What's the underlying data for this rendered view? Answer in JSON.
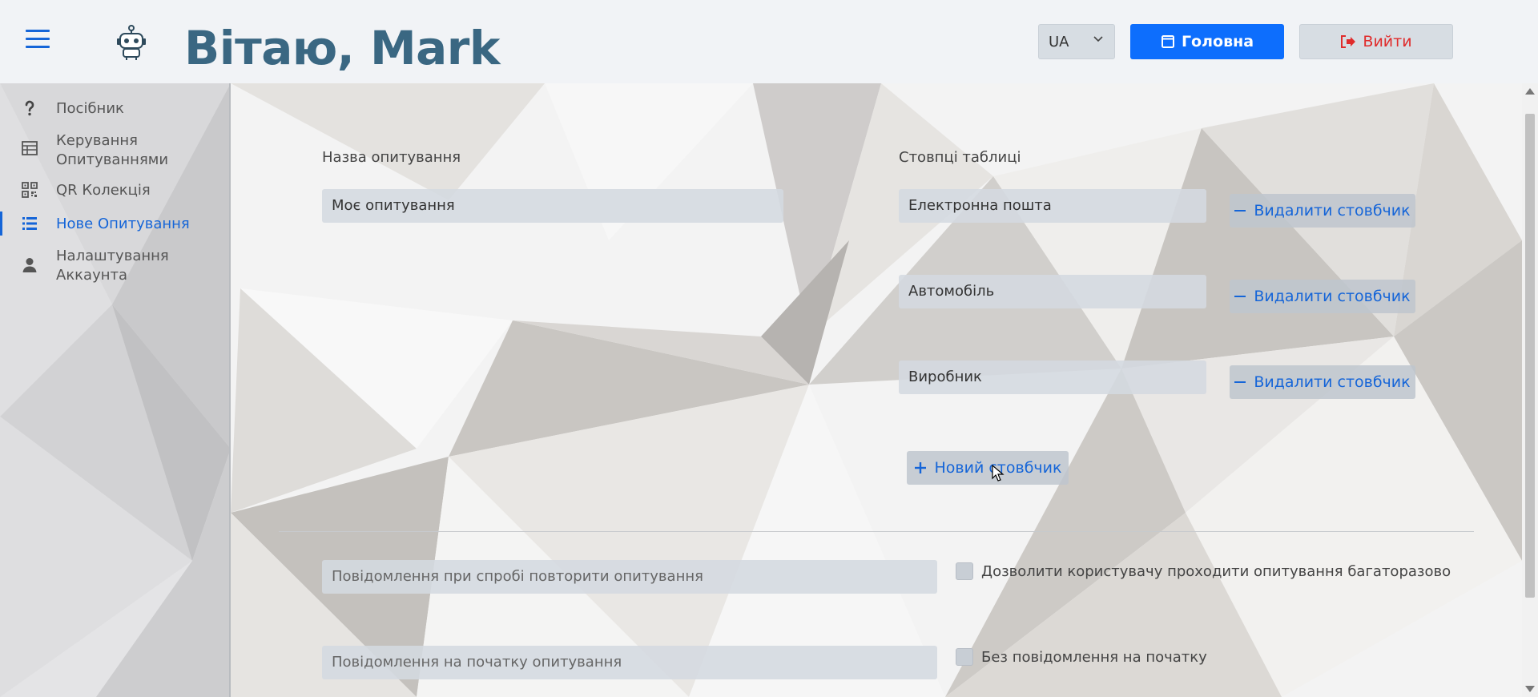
{
  "header": {
    "greeting": "Вітаю, Mark",
    "language": "UA",
    "home_label": "Головна",
    "logout_label": "Вийти"
  },
  "sidebar": {
    "items": [
      {
        "label": "Посібник",
        "icon": "question-icon"
      },
      {
        "label": "Керування Опитуваннями",
        "icon": "table-icon"
      },
      {
        "label": "QR Колекція",
        "icon": "qr-icon"
      },
      {
        "label": "Нове Опитування",
        "icon": "list-icon",
        "active": true
      },
      {
        "label": "Налаштування Аккаунта",
        "icon": "user-icon"
      }
    ]
  },
  "form": {
    "survey_name_label": "Назва опитування",
    "survey_name_value": "Моє опитування",
    "columns_label": "Стовпці таблиці",
    "columns": [
      {
        "value": "Електронна пошта",
        "delete_label": "Видалити стовбчик"
      },
      {
        "value": "Автомобіль",
        "delete_label": "Видалити стовбчик"
      },
      {
        "value": "Виробник",
        "delete_label": "Видалити стовбчик"
      }
    ],
    "new_column_label": "Новий стовбчик",
    "repeat_message_placeholder": "Повідомлення при спробі повторити опитування",
    "allow_repeat_label": "Дозволити користувачу проходити опитування багаторазово",
    "start_message_placeholder": "Повідомлення на початку опитування",
    "no_start_message_label": "Без повідомлення на початку"
  },
  "colors": {
    "accent": "#1565d8",
    "primary_button": "#0d6efd",
    "greeting": "#3a6782",
    "logout": "#e02b2b"
  }
}
